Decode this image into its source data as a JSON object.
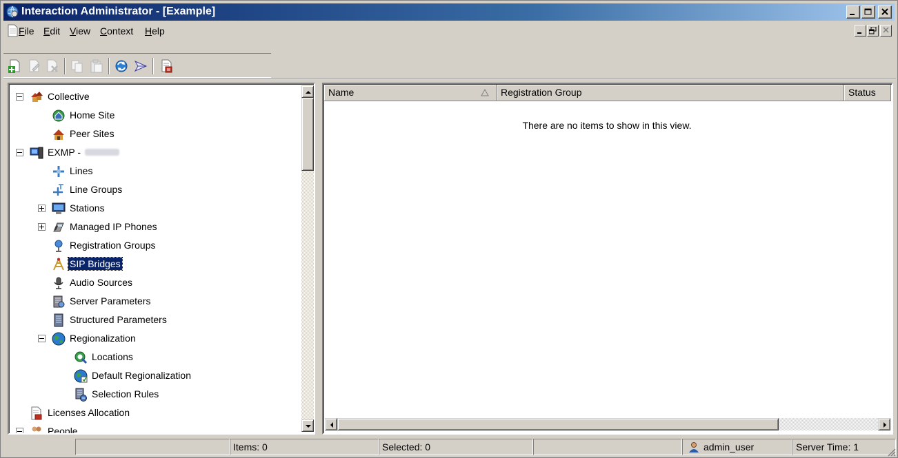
{
  "window": {
    "title": "Interaction Administrator - [Example]",
    "icons": {
      "app": "globe-app-icon",
      "minimize": "minimize-icon",
      "maximize": "maximize-icon",
      "close": "close-icon"
    }
  },
  "menubar": {
    "items": [
      {
        "label": "File",
        "accel": "F"
      },
      {
        "label": "Edit",
        "accel": "E"
      },
      {
        "label": "View",
        "accel": "V"
      },
      {
        "label": "Context",
        "accel": "C"
      },
      {
        "label": "Help",
        "accel": "H"
      }
    ],
    "mdi_icons": [
      "mdi-minimize-icon",
      "mdi-restore-icon",
      "mdi-close-icon"
    ]
  },
  "toolbar": {
    "buttons": [
      {
        "name": "new-icon",
        "enabled": true
      },
      {
        "name": "edit-icon",
        "enabled": false
      },
      {
        "name": "delete-icon",
        "enabled": false
      },
      {
        "name": "copy-icon",
        "enabled": false
      },
      {
        "name": "paste-icon",
        "enabled": false
      },
      {
        "name": "refresh-icon",
        "enabled": true
      },
      {
        "name": "bridge-icon",
        "enabled": true
      },
      {
        "name": "report-icon",
        "enabled": true
      }
    ]
  },
  "tree": {
    "items": [
      {
        "label": "Collective",
        "level": 0,
        "expander": "minus",
        "icon": "collective-icon"
      },
      {
        "label": "Home Site",
        "level": 1,
        "icon": "home-site-icon"
      },
      {
        "label": "Peer Sites",
        "level": 1,
        "icon": "peer-sites-icon"
      },
      {
        "label": "EXMP -",
        "level": 0,
        "expander": "minus",
        "icon": "server-icon",
        "blurred_suffix": true
      },
      {
        "label": "Lines",
        "level": 1,
        "icon": "lines-icon"
      },
      {
        "label": "Line Groups",
        "level": 1,
        "icon": "line-groups-icon"
      },
      {
        "label": "Stations",
        "level": 1,
        "expander": "plus",
        "icon": "stations-icon"
      },
      {
        "label": "Managed IP Phones",
        "level": 1,
        "expander": "plus",
        "icon": "ip-phone-icon"
      },
      {
        "label": "Registration Groups",
        "level": 1,
        "icon": "registration-groups-icon"
      },
      {
        "label": "SIP Bridges",
        "level": 1,
        "icon": "sip-bridge-icon",
        "selected": true
      },
      {
        "label": "Audio Sources",
        "level": 1,
        "icon": "audio-sources-icon"
      },
      {
        "label": "Server Parameters",
        "level": 1,
        "icon": "server-parameters-icon"
      },
      {
        "label": "Structured Parameters",
        "level": 1,
        "icon": "structured-parameters-icon"
      },
      {
        "label": "Regionalization",
        "level": 1,
        "expander": "minus",
        "icon": "regionalization-icon"
      },
      {
        "label": "Locations",
        "level": 2,
        "icon": "locations-icon"
      },
      {
        "label": "Default Regionalization",
        "level": 2,
        "icon": "default-regionalization-icon"
      },
      {
        "label": "Selection Rules",
        "level": 2,
        "icon": "selection-rules-icon"
      },
      {
        "label": "Licenses Allocation",
        "level": 0,
        "icon": "licenses-icon",
        "no_expander_indent": true
      },
      {
        "label": "People",
        "level": 0,
        "expander": "minus",
        "icon": "people-icon"
      }
    ]
  },
  "list": {
    "columns": [
      {
        "label": "Name",
        "sorted": "ascending"
      },
      {
        "label": "Registration Group"
      },
      {
        "label": "Status"
      }
    ],
    "empty_message": "There are no items to show in this view."
  },
  "statusbar": {
    "items_label": "Items: 0",
    "selected_label": "Selected: 0",
    "user": "admin_user",
    "server_time": "Server Time: 1",
    "user_icon": "user-icon"
  }
}
